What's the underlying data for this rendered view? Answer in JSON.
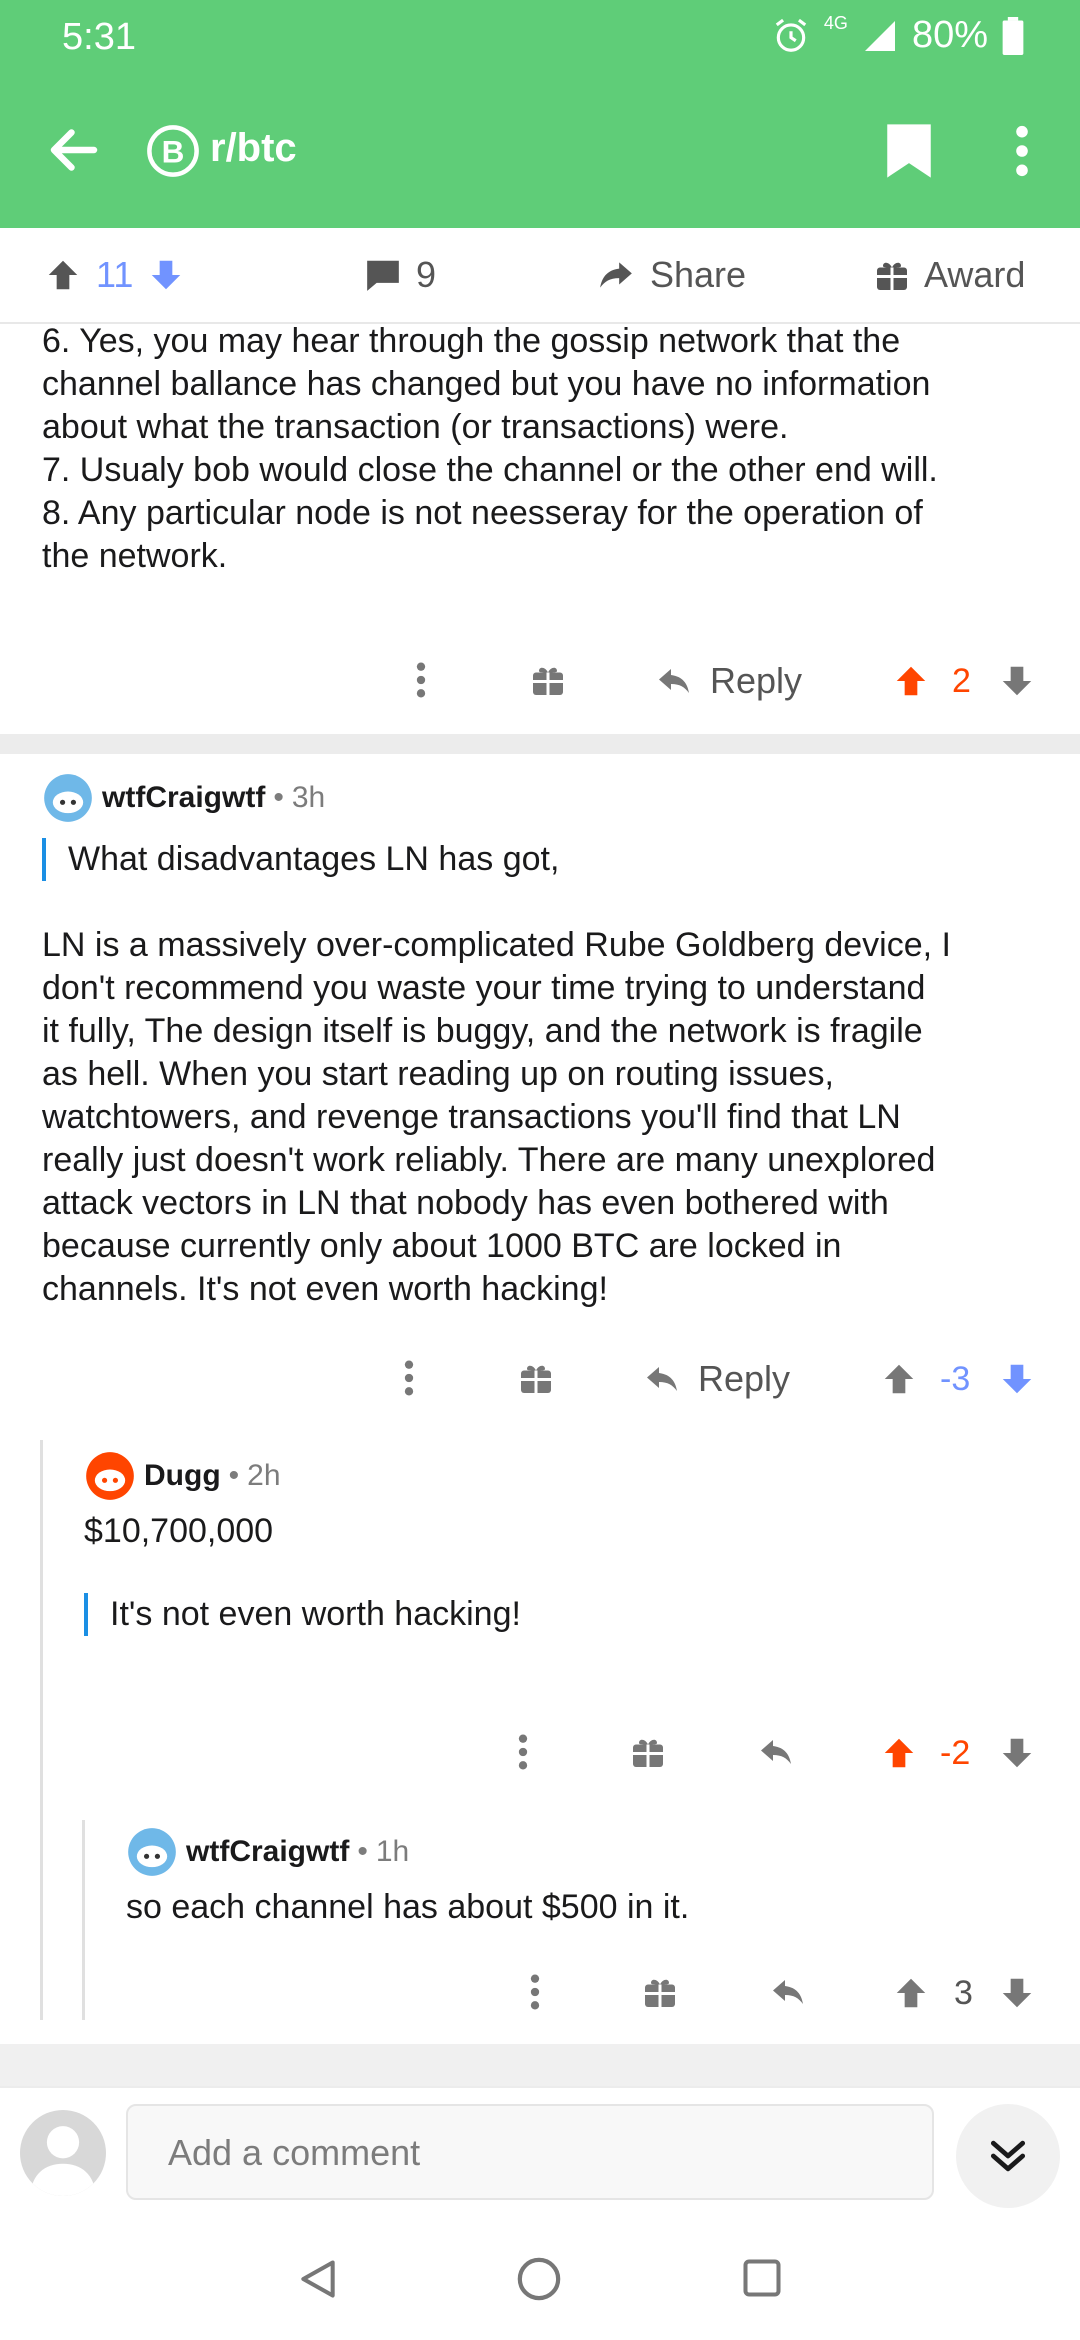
{
  "status_bar": {
    "time": "5:31",
    "network": "4G",
    "battery": "80%"
  },
  "header": {
    "subreddit": "r/btc"
  },
  "post_actions": {
    "upvotes": "11",
    "comments": "9",
    "share": "Share",
    "award": "Award"
  },
  "comments": [
    {
      "id": "c1",
      "body_lines": [
        "6. Yes, you may hear through the gossip network that the",
        "channel ballance has changed but you have no information",
        "about what the transaction (or transactions) were.",
        "7. Usualy bob would close the channel or the other end will.",
        "8. Any particular node is not neesseray for the operation of",
        "the network."
      ],
      "reply": "Reply",
      "score": "2"
    },
    {
      "id": "c2",
      "user": "wtfCraigwtf",
      "age": "3h",
      "quote": "What disadvantages LN has got,",
      "body_lines": [
        "LN is a massively over-complicated Rube Goldberg device, I",
        "don't recommend you waste your time trying to understand",
        "it fully, The design itself is buggy, and the network is fragile",
        "as hell. When you start reading up on routing issues,",
        "watchtowers, and revenge transactions you'll find that LN",
        "really just doesn't work reliably. There are many unexplored",
        "attack vectors in LN that nobody has even bothered with",
        "because currently only about 1000 BTC are locked in",
        "channels. It's not even worth hacking!"
      ],
      "reply": "Reply",
      "score": "-3"
    },
    {
      "id": "c3",
      "user": "Dugg",
      "age": "2h",
      "body": "$10,700,000",
      "quote": "It's not even worth hacking!",
      "score": "-2"
    },
    {
      "id": "c4",
      "user": "wtfCraigwtf",
      "age": "1h",
      "body": "so each channel has about $500 in it.",
      "score": "3"
    }
  ],
  "compose": {
    "placeholder": "Add a comment"
  },
  "colors": {
    "header_green": "#5fcd78",
    "upvote_orange": "#ff4500",
    "downvote_blue": "#7193ff",
    "quote_blue": "#1b8fe4"
  }
}
